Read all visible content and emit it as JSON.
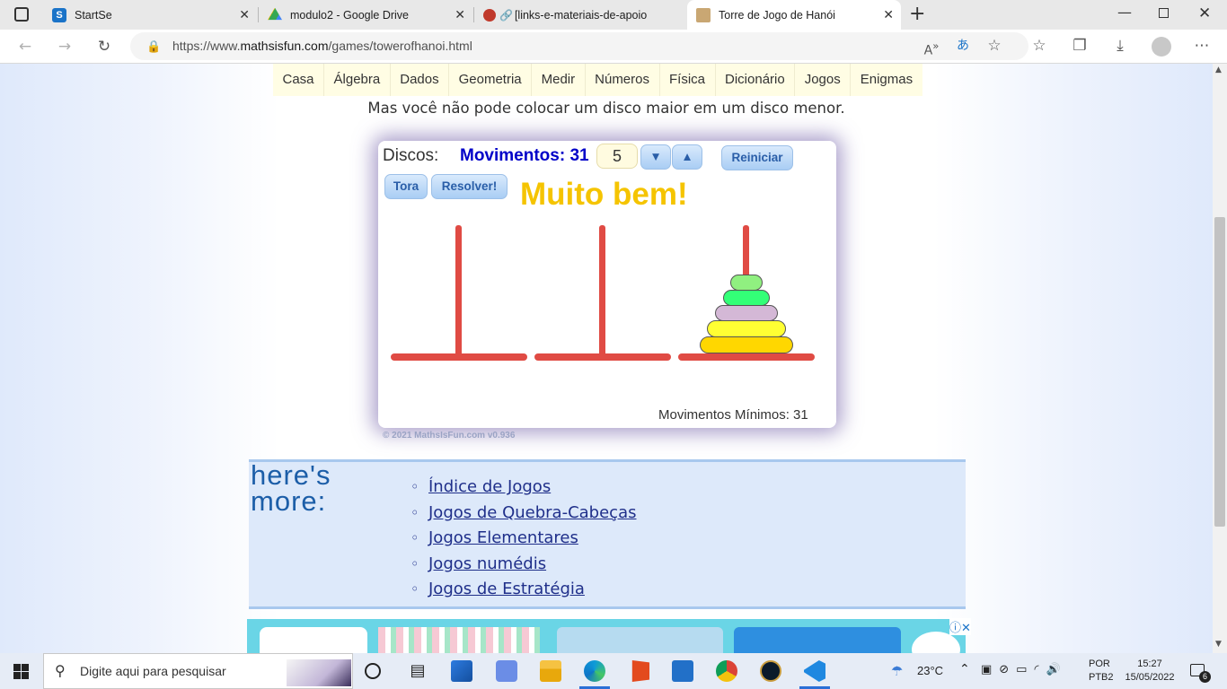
{
  "browser": {
    "tabs": [
      {
        "label": "StartSe",
        "color": "#1a73c8"
      },
      {
        "label": "modulo2 - Google Drive",
        "color": "#34a853"
      },
      {
        "label": "[links-e-materiais-de-apoio",
        "color": "#c0392b"
      },
      {
        "label": "Torre de Jogo de Hanói",
        "color": "#7a5d3a"
      }
    ],
    "url_prefix": "https://www.",
    "url_domain": "mathsisfun.com",
    "url_path": "/games/towerofhanoi.html"
  },
  "menu": [
    "Casa",
    "Álgebra",
    "Dados",
    "Geometria",
    "Medir",
    "Números",
    "Física",
    "Dicionário",
    "Jogos",
    "Enigmas"
  ],
  "note": "Mas você não pode colocar um disco maior em um disco menor.",
  "game": {
    "discs_label": "Discos:",
    "moves_label": "Movimentos: 31",
    "disc_count": "5",
    "down": "▼",
    "up": "▲",
    "reset": "Reiniciar",
    "tower": "Tora",
    "solve": "Resolver!",
    "message": "Muito bem!",
    "min_moves": "Movimentos Mínimos: 31",
    "copyright": "© 2021 MathsIsFun.com v0.936",
    "disk_colors": [
      "#90f080",
      "#33ff77",
      "#d4b8d6",
      "#ffff33",
      "#ffd700"
    ]
  },
  "more": {
    "heading_line1": "here's",
    "heading_line2": "more:",
    "links": [
      "Índice de Jogos",
      "Jogos de Quebra-Cabeças",
      "Jogos Elementares",
      "Jogos numédis",
      "Jogos de Estratégia"
    ]
  },
  "taskbar": {
    "search_placeholder": "Digite aqui para pesquisar",
    "weather": "23°C",
    "lang1": "POR",
    "lang2": "PTB2",
    "time": "15:27",
    "date": "15/05/2022",
    "notif_count": "6"
  }
}
